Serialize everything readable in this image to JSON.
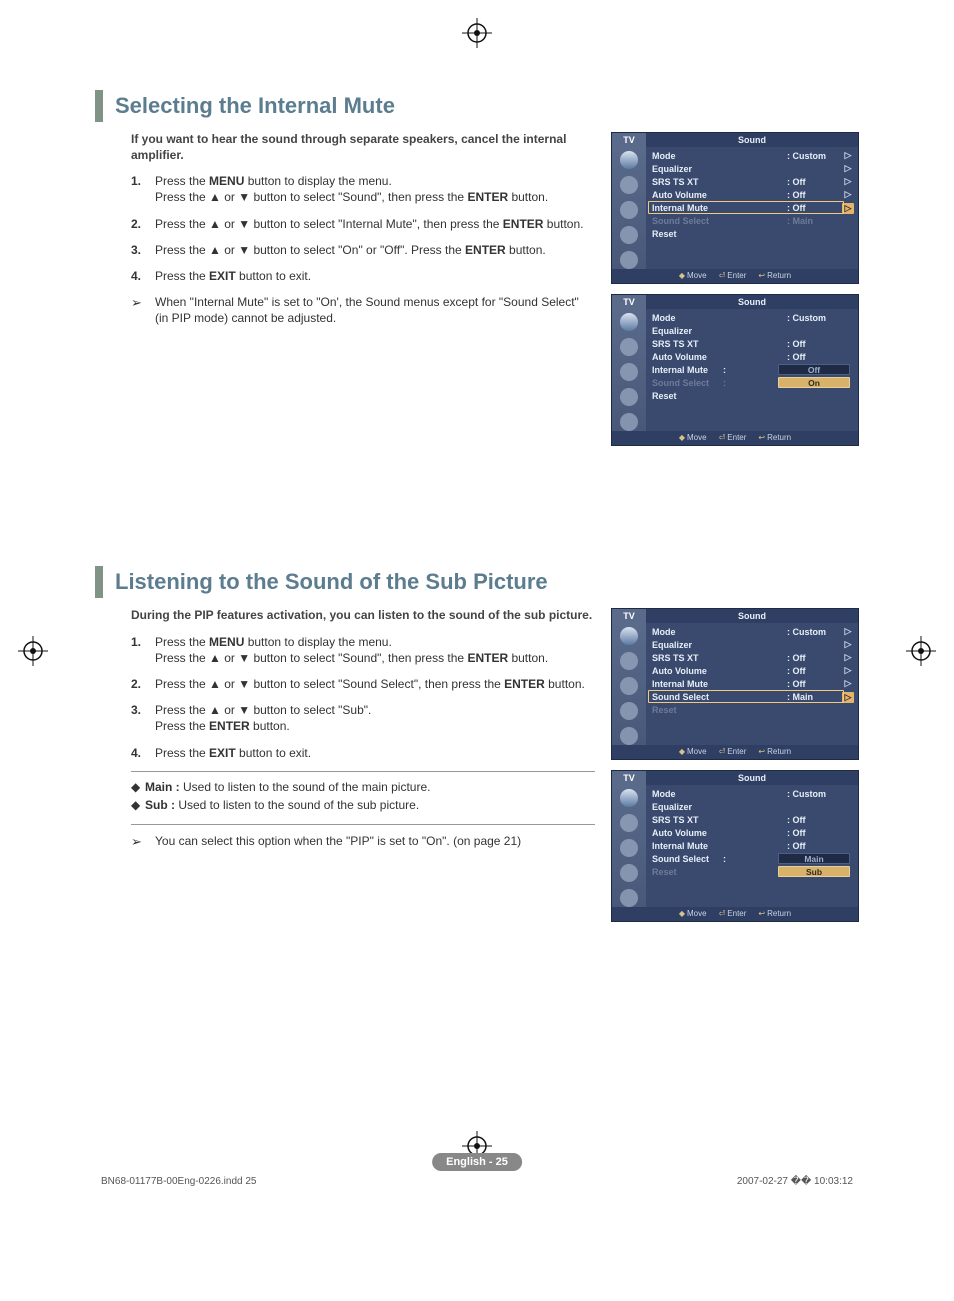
{
  "section1": {
    "title": "Selecting the Internal Mute",
    "intro": "If you want to hear the sound through separate speakers, cancel the internal amplifier.",
    "steps": {
      "s1_a": "Press the ",
      "s1_menu": "MENU",
      "s1_b": " button to display the menu.",
      "s1_c": "Press the ▲ or ▼ button to select \"Sound\", then press the ",
      "enter1": "ENTER",
      "s1_d": " button.",
      "s2_a": "Press the ▲ or ▼ button to select \"Internal Mute\", then press the ",
      "enter2": "ENTER",
      "s2_b": " button.",
      "s3_a": "Press the ▲ or ▼ button to select \"On\" or \"Off\". Press the ",
      "enter3": "ENTER",
      "s3_b": " button.",
      "s4_a": "Press the ",
      "exit": "EXIT",
      "s4_b": " button to exit."
    },
    "note": "When \"Internal Mute\" is set to \"On', the Sound menus except for \"Sound Select\" (in PIP mode) cannot be adjusted."
  },
  "section2": {
    "title": "Listening to the Sound of the Sub Picture",
    "intro": "During the PIP features activation, you can listen to the sound of the sub picture.",
    "steps": {
      "s1_a": "Press the ",
      "s1_menu": "MENU",
      "s1_b": " button to display the menu.",
      "s1_c": "Press the ▲ or ▼ button to select \"Sound\", then press the ",
      "enter1": "ENTER",
      "s1_d": " button.",
      "s2_a": "Press the ▲ or ▼ button to select \"Sound Select\", then press the ",
      "enter2": "ENTER",
      "s2_b": " button.",
      "s3_a": "Press the ▲ or ▼ button to select \"Sub\".",
      "s3_b": "Press the ",
      "enter3": "ENTER",
      "s3_c": " button.",
      "s4_a": "Press the ",
      "exit": "EXIT",
      "s4_b": " button to exit."
    },
    "defs": {
      "main_label": "Main :",
      "main_text": " Used to listen to the sound of the main picture.",
      "sub_label": "Sub :",
      "sub_text": "  Used to listen to the sound of the sub picture."
    },
    "note": "You can select this option when the \"PIP\" is set to \"On\". (on page 21)"
  },
  "osd": {
    "tv": "TV",
    "header": "Sound",
    "rows": {
      "mode": "Mode",
      "equalizer": "Equalizer",
      "srs": "SRS TS XT",
      "auto_volume": "Auto Volume",
      "internal_mute": "Internal Mute",
      "sound_select": "Sound Select",
      "reset": "Reset"
    },
    "values": {
      "custom": ": Custom",
      "off": ": Off",
      "main": ": Main",
      "colon": ":"
    },
    "options": {
      "off": "Off",
      "on": "On",
      "main": "Main",
      "sub": "Sub"
    },
    "footer": {
      "move": "Move",
      "enter": "Enter",
      "return": "Return"
    }
  },
  "page_badge": "English - 25",
  "footer": {
    "left": "BN68-01177B-00Eng-0226.indd   25",
    "right": "2007-02-27   �� 10:03:12"
  }
}
